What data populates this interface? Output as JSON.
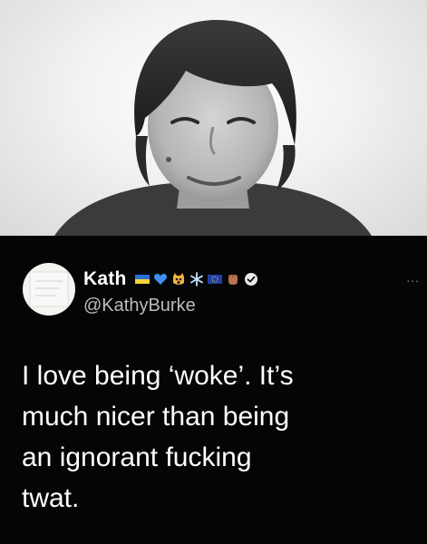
{
  "photo": {
    "alt_desc": ""
  },
  "tweet": {
    "display_name": "Kath",
    "handle": "@KathyBurke",
    "more_label": "...",
    "verified": true,
    "emoji_icons": [
      "ukraine-flag-icon",
      "blue-heart-icon",
      "screaming-cat-icon",
      "snowflake-icon",
      "eu-flag-icon",
      "raised-fist-icon"
    ],
    "text_lines": [
      "I love being ‘woke’. It’s",
      "much nicer than being",
      "an ignorant fucking",
      "twat."
    ]
  },
  "colors": {
    "background": "#050505",
    "text": "#ffffff",
    "handle": "#b9bcc0"
  }
}
